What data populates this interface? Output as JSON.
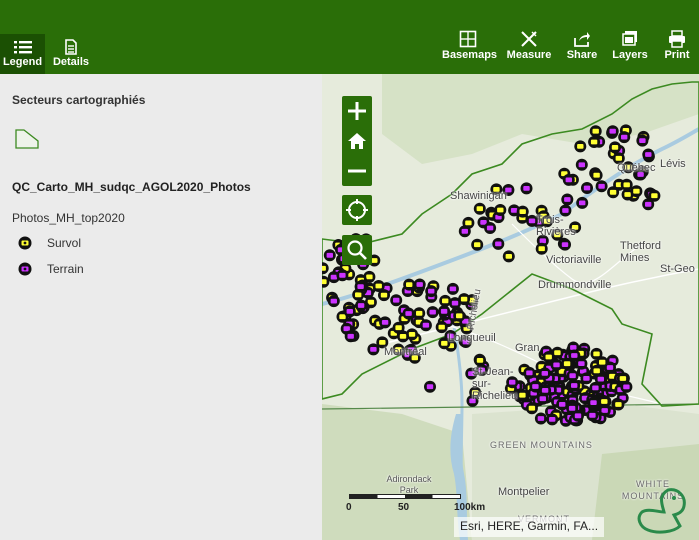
{
  "header": {
    "tabs": [
      {
        "id": "legend",
        "label": "Legend",
        "icon": "list-icon",
        "active": true
      },
      {
        "id": "details",
        "label": "Details",
        "icon": "document-icon",
        "active": false
      }
    ],
    "tools": [
      {
        "id": "basemaps",
        "label": "Basemaps",
        "icon": "basemaps-icon"
      },
      {
        "id": "measure",
        "label": "Measure",
        "icon": "ruler-pencil-icon"
      },
      {
        "id": "share",
        "label": "Share",
        "icon": "share-icon"
      },
      {
        "id": "layers",
        "label": "Layers",
        "icon": "layers-icon"
      },
      {
        "id": "print",
        "label": "Print",
        "icon": "printer-icon"
      }
    ]
  },
  "legend": {
    "sector_title": "Secteurs cartographiés",
    "layer_title": "QC_Carto_MH_sudqc_AGOL2020_Photos",
    "sublayer_title": "Photos_MH_top2020",
    "items": [
      {
        "label": "Survol",
        "symbol": "survol-camera-icon",
        "color": "#ffff33"
      },
      {
        "label": "Terrain",
        "symbol": "terrain-camera-icon",
        "color": "#cc33ff"
      }
    ]
  },
  "map": {
    "labels": {
      "quebec": "Québec",
      "levis": "Lévis",
      "shawinigan": "Shawinigan",
      "trois_rivieres": "Trois-Rivières",
      "victoriaville": "Victoriaville",
      "thetford": "Thetford Mines",
      "stgeo": "St-Geo",
      "drummondville": "Drummondville",
      "longueuil": "Longueuil",
      "montreal": "Montréal",
      "granby": "Gran",
      "stjean": "St-Jean-sur-Richelieu",
      "green_mountains": "GREEN MOUNTAINS",
      "adirondack": "Adirondack Park",
      "montpelier": "Montpelier",
      "white_mountains": "WHITE MOUNTAINS",
      "vermont": "VERMONT",
      "richelieu": "Richelieu"
    },
    "scale": {
      "zero": "0",
      "mid": "50",
      "end": "100km"
    },
    "attribution": "Esri, HERE, Garmin, FA..."
  },
  "colors": {
    "header": "#2a6e08",
    "active_tab": "#1b5003",
    "survol": "#ffff33",
    "terrain": "#cc33ff",
    "sector_outline": "#3c8a21"
  }
}
